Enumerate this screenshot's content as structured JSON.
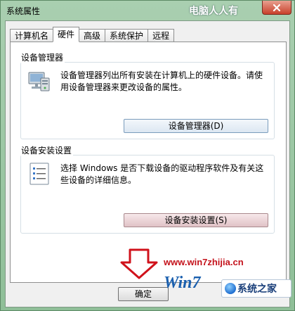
{
  "window": {
    "title": "系统属性",
    "watermark_top": "电脑人人有"
  },
  "tabs": [
    {
      "label": "计算机名"
    },
    {
      "label": "硬件",
      "active": true
    },
    {
      "label": "高级"
    },
    {
      "label": "系统保护"
    },
    {
      "label": "远程"
    }
  ],
  "device_manager": {
    "label": "设备管理器",
    "description": "设备管理器列出所有安装在计算机上的硬件设备。请使用设备管理器来更改设备的属性。",
    "button": "设备管理器(D)",
    "icon": "device-manager-icon"
  },
  "device_install": {
    "label": "设备安装设置",
    "description": "选择 Windows 是否下载设备的驱动程序软件及有关这些设备的详细信息。",
    "button": "设备安装设置(S)",
    "icon": "checklist-icon"
  },
  "footer": {
    "ok": "确定"
  },
  "watermark": {
    "url": "www.win7zhijia.cn",
    "logo_text": "Win7",
    "badge": "系统之家"
  },
  "colors": {
    "frame": "#9fc3a0",
    "close": "#c8402a",
    "accent_red": "#c4121b",
    "logo_blue": "#1a5fae"
  }
}
